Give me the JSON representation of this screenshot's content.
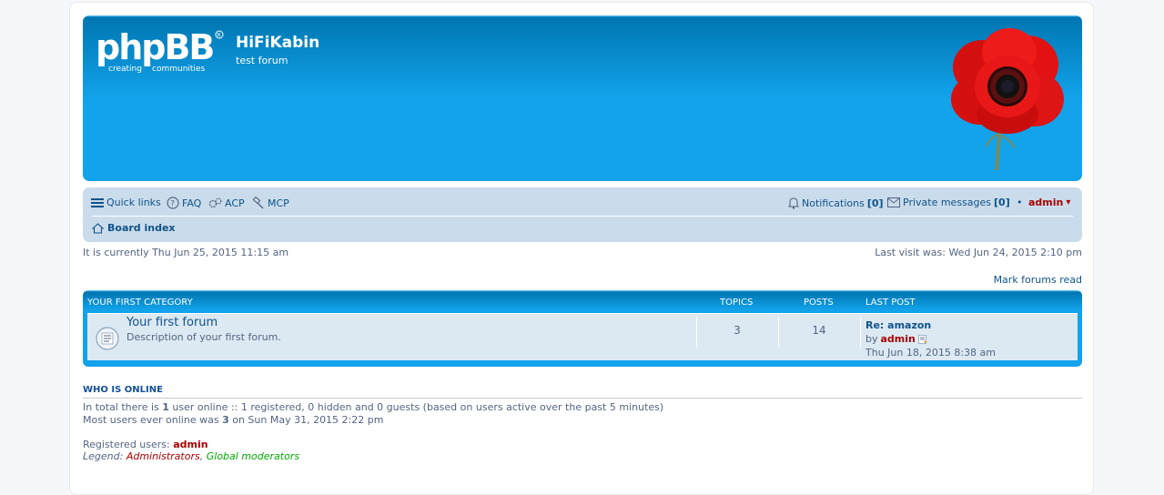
{
  "site": {
    "title": "HiFiKabin",
    "description": "test forum",
    "logo_text": "phpBB",
    "logo_tagline_1": "creating",
    "logo_tagline_2": "communities"
  },
  "nav": {
    "quick_links": "Quick links",
    "faq": "FAQ",
    "acp": "ACP",
    "mcp": "MCP",
    "notifications_label": "Notifications",
    "notifications_count": "[0]",
    "pm_label": "Private messages",
    "pm_count": "[0]",
    "bullet": "•",
    "user": "admin",
    "user_caret": "▾",
    "board_index": "Board index"
  },
  "status": {
    "current_time": "It is currently Thu Jun 25, 2015 11:15 am",
    "last_visit": "Last visit was: Wed Jun 24, 2015 2:10 pm",
    "mark_read": "Mark forums read"
  },
  "forum_table": {
    "category": "YOUR FIRST CATEGORY",
    "col_topics": "TOPICS",
    "col_posts": "POSTS",
    "col_last_post": "LAST POST",
    "rows": [
      {
        "title": "Your first forum",
        "description": "Description of your first forum.",
        "topics": "3",
        "posts": "14",
        "last_post_title": "Re: amazon",
        "last_post_by": "by",
        "last_post_author": "admin",
        "last_post_time": "Thu Jun 18, 2015 8:38 am"
      }
    ]
  },
  "online": {
    "heading": "WHO IS ONLINE",
    "line1_a": "In total there is ",
    "line1_count": "1",
    "line1_b": " user online :: 1 registered, 0 hidden and 0 guests (based on users active over the past 5 minutes)",
    "line2_a": "Most users ever online was ",
    "line2_count": "3",
    "line2_b": " on Sun May 31, 2015 2:22 pm",
    "registered_label": "Registered users: ",
    "registered_user": "admin",
    "legend_label": "Legend: ",
    "legend_admins": "Administrators",
    "legend_sep": ", ",
    "legend_mods": "Global moderators"
  },
  "colors": {
    "header_blue": "#12a3eb",
    "nav_bg": "#cadceb",
    "link": "#105289",
    "admin": "#aa0000",
    "moderator": "#00aa00"
  }
}
